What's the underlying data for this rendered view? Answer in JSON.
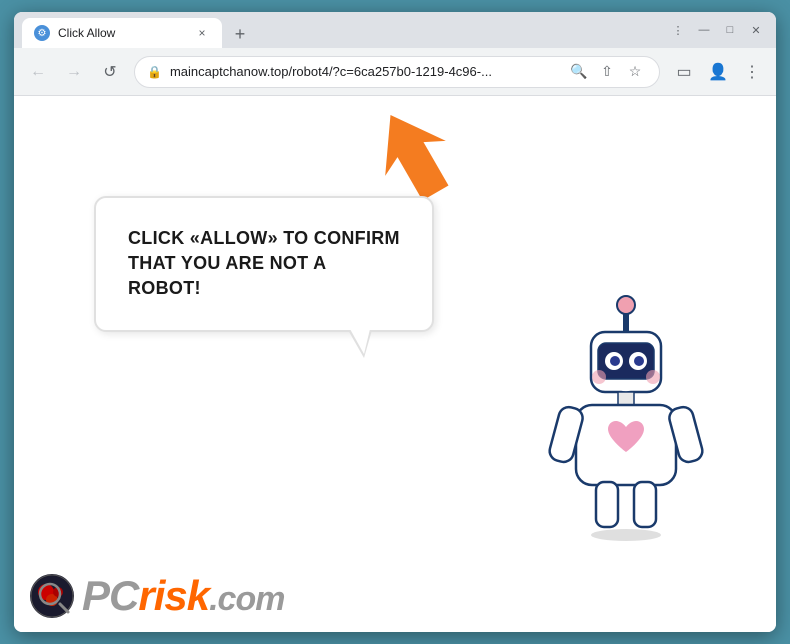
{
  "browser": {
    "title": "Click Allow",
    "url": "maincaptchanow.top/robot4/?c=6ca257b0-1219-4c96-...",
    "tab": {
      "title": "Click Allow",
      "close_label": "×"
    },
    "new_tab_label": "+",
    "window_controls": {
      "minimize": "—",
      "maximize": "□",
      "close": "✕"
    },
    "nav": {
      "back": "←",
      "forward": "→",
      "refresh": "↺"
    },
    "address_icons": {
      "search": "🔍",
      "share": "⇧",
      "bookmark": "☆",
      "sidebar": "▭",
      "profile": "👤",
      "menu": "⋮"
    }
  },
  "page": {
    "bubble_text": "CLICK «ALLOW» TO CONFIRM THAT YOU ARE NOT A ROBOT!",
    "logo_text": "PC",
    "logo_text2": "risk",
    "logo_text3": ".com"
  }
}
